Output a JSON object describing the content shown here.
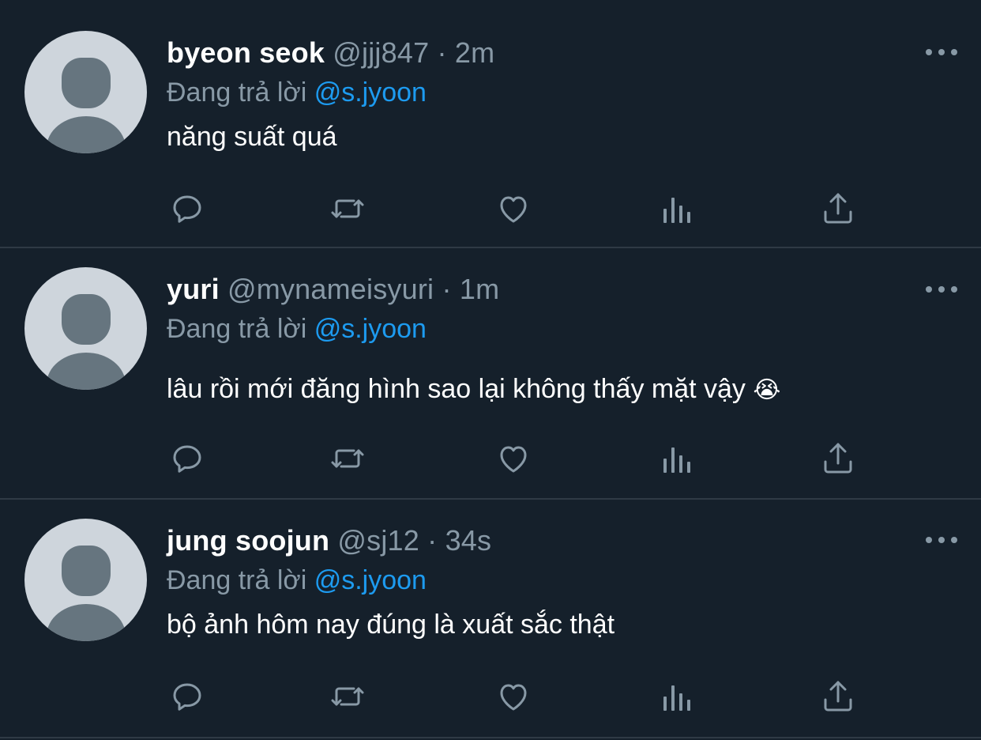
{
  "tweets": [
    {
      "name": "byeon seok",
      "handle": "@jjj847",
      "separator": "·",
      "time": "2m",
      "reply_prefix": "Đang trả lời",
      "reply_to": "@s.jyoon",
      "text": "năng suất quá"
    },
    {
      "name": "yuri",
      "handle": "@mynameisyuri",
      "separator": "·",
      "time": "1m",
      "reply_prefix": "Đang trả lời",
      "reply_to": "@s.jyoon",
      "text": "lâu rồi mới đăng hình sao lại không thấy mặt vậy",
      "emoji": "😭"
    },
    {
      "name": "jung soojun",
      "handle": "@sj12",
      "separator": "·",
      "time": "34s",
      "reply_prefix": "Đang trả lời",
      "reply_to": "@s.jyoon",
      "text": "bộ ảnh hôm nay đúng là xuất sắc thật"
    }
  ],
  "icons": {
    "reply": "comment-bubble-icon",
    "retweet": "retweet-icon",
    "like": "heart-icon",
    "views": "analytics-bars-icon",
    "share": "share-upload-icon",
    "more": "more-dots-icon",
    "avatar": "default-avatar-icon"
  },
  "colors": {
    "background": "#15202b",
    "divider": "#2f3a45",
    "muted": "#8899a6",
    "accent": "#1d9bf0",
    "avatar_bg": "#ced5dc",
    "avatar_fg": "#66757f"
  }
}
